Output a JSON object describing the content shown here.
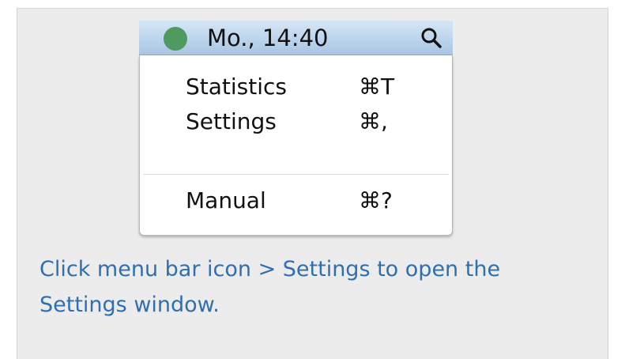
{
  "menubar": {
    "status_color": "#4e9a61",
    "clock": "Mo., 14:40",
    "search_icon": "magnifier-icon"
  },
  "menu": {
    "items": [
      {
        "label": "Statistics",
        "shortcut": "⌘T"
      },
      {
        "label": "Settings",
        "shortcut": "⌘,"
      },
      {
        "label": "Manual",
        "shortcut": "⌘?"
      }
    ]
  },
  "caption": "Click menu bar icon > Settings to open the Settings window.",
  "colors": {
    "caption": "#2f6fb0",
    "panel_background": "#ececec"
  }
}
